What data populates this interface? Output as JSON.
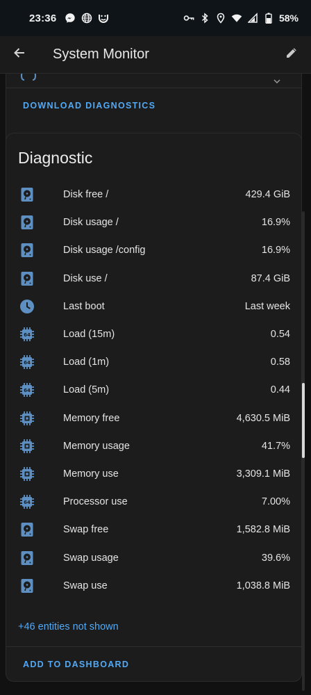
{
  "status_bar": {
    "time": "23:36",
    "left_icons": [
      "messenger-icon",
      "globe-icon",
      "smile-icon"
    ],
    "right_icons": [
      "vpn-key-icon",
      "bluetooth-icon",
      "location-icon",
      "wifi-icon",
      "signal-icon",
      "battery-icon"
    ],
    "battery": "58%"
  },
  "app_bar": {
    "title": "System Monitor"
  },
  "top_card": {
    "action_label": "DOWNLOAD DIAGNOSTICS"
  },
  "diagnostic": {
    "title": "Diagnostic",
    "rows": [
      {
        "icon": "harddisk-icon",
        "label": "Disk free /",
        "value": "429.4 GiB"
      },
      {
        "icon": "harddisk-icon",
        "label": "Disk usage /",
        "value": "16.9%"
      },
      {
        "icon": "harddisk-icon",
        "label": "Disk usage /config",
        "value": "16.9%"
      },
      {
        "icon": "harddisk-icon",
        "label": "Disk use /",
        "value": "87.4 GiB"
      },
      {
        "icon": "clock-icon",
        "label": "Last boot",
        "value": "Last week"
      },
      {
        "icon": "cpu-64-icon",
        "label": "Load (15m)",
        "value": "0.54"
      },
      {
        "icon": "cpu-64-icon",
        "label": "Load (1m)",
        "value": "0.58"
      },
      {
        "icon": "cpu-64-icon",
        "label": "Load (5m)",
        "value": "0.44"
      },
      {
        "icon": "memory-icon",
        "label": "Memory free",
        "value": "4,630.5 MiB"
      },
      {
        "icon": "memory-icon",
        "label": "Memory usage",
        "value": "41.7%"
      },
      {
        "icon": "memory-icon",
        "label": "Memory use",
        "value": "3,309.1 MiB"
      },
      {
        "icon": "cpu-64-icon",
        "label": "Processor use",
        "value": "7.00%"
      },
      {
        "icon": "harddisk-icon",
        "label": "Swap free",
        "value": "1,582.8 MiB"
      },
      {
        "icon": "harddisk-icon",
        "label": "Swap usage",
        "value": "39.6%"
      },
      {
        "icon": "harddisk-icon",
        "label": "Swap use",
        "value": "1,038.8 MiB"
      }
    ],
    "more_link": "+46 entities not shown",
    "action_label": "ADD TO DASHBOARD"
  },
  "colors": {
    "accent": "#52a9f5",
    "icon": "#5d8fc2",
    "background": "#111111",
    "card": "#1c1c1c"
  }
}
